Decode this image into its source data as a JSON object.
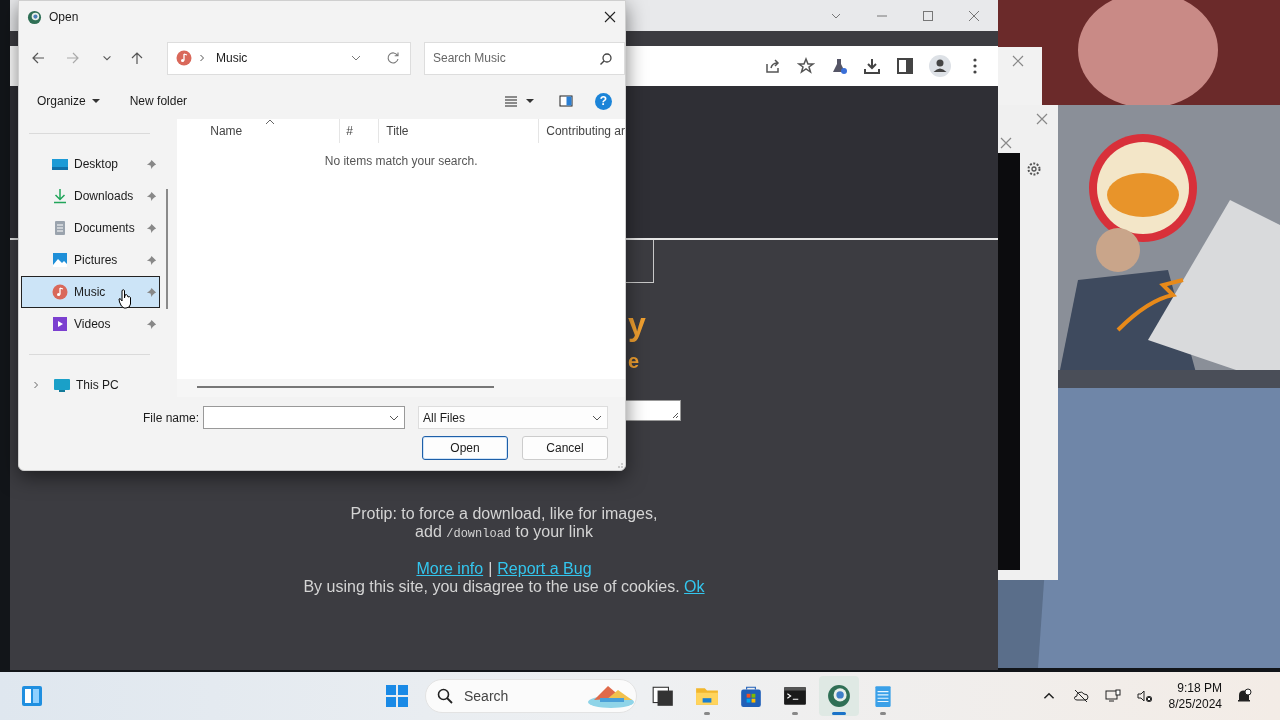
{
  "dialog": {
    "title": "Open",
    "address": "Music",
    "search_placeholder": "Search Music",
    "organize": "Organize",
    "new_folder": "New folder",
    "help": "?",
    "nav_items": [
      {
        "label": "Desktop",
        "kind": "desktop",
        "pinned": true,
        "selected": false
      },
      {
        "label": "Downloads",
        "kind": "downloads",
        "pinned": true,
        "selected": false
      },
      {
        "label": "Documents",
        "kind": "documents",
        "pinned": true,
        "selected": false
      },
      {
        "label": "Pictures",
        "kind": "pictures",
        "pinned": true,
        "selected": false
      },
      {
        "label": "Music",
        "kind": "music",
        "pinned": true,
        "selected": true
      },
      {
        "label": "Videos",
        "kind": "videos",
        "pinned": true,
        "selected": false
      }
    ],
    "this_pc": {
      "label": "This PC",
      "expanded": false
    },
    "columns": [
      "Name",
      "#",
      "Title",
      "Contributing ar"
    ],
    "empty_message": "No items match your search.",
    "file_name_label": "File name:",
    "file_type": "All Files",
    "buttons": [
      {
        "label": "Open",
        "kind": "primary"
      },
      {
        "label": "Cancel",
        "kind": "secondary"
      }
    ]
  },
  "page": {
    "heading_fragment": "y",
    "subheading_fragment": "e",
    "protip": "Protip: to force a download, like for images,",
    "protip_add": "add",
    "protip_code": "/download",
    "protip_end": "to your link",
    "links": [
      "More info",
      "Report a Bug"
    ],
    "separator": "|",
    "cookie_text": "By using this site, you disagree to the use of cookies.",
    "cookie_link": "Ok"
  },
  "taskbar": {
    "search_placeholder": "Search",
    "apps": [
      {
        "kind": "task-view",
        "running": false,
        "active": false
      },
      {
        "kind": "file-explorer",
        "running": true,
        "active": false
      },
      {
        "kind": "store",
        "running": false,
        "active": false
      },
      {
        "kind": "terminal",
        "running": true,
        "active": false
      },
      {
        "kind": "browser",
        "running": true,
        "active": true
      },
      {
        "kind": "notepad",
        "running": true,
        "active": false
      }
    ],
    "time": "9:18 PM",
    "date": "8/25/2024"
  }
}
